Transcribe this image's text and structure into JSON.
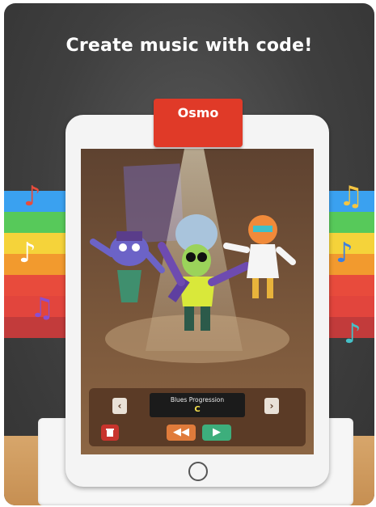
{
  "header": {
    "title": "Create music with code!"
  },
  "device": {
    "clip_brand": "Osmo"
  },
  "stripe_colors": [
    "#3aa1f0",
    "#57c95a",
    "#f5d33a",
    "#f29a2e",
    "#e84b3c",
    "#e2453d",
    "#c23b3b"
  ],
  "notes": [
    {
      "name": "red-note-icon",
      "glyph": "♪",
      "color": "#e74c3c"
    },
    {
      "name": "white-note-icon",
      "glyph": "♪",
      "color": "#ffffff"
    },
    {
      "name": "purple-note-icon",
      "glyph": "♫",
      "color": "#8a4fd1"
    },
    {
      "name": "yellow-note-icon",
      "glyph": "♫",
      "color": "#f5c542"
    },
    {
      "name": "blue-note-icon",
      "glyph": "♪",
      "color": "#3b7fe0"
    },
    {
      "name": "teal-note-icon",
      "glyph": "♪",
      "color": "#45c1c8"
    }
  ],
  "panel": {
    "song_label": "Blues Progression",
    "chord": "C",
    "prev_icon": "chevron-left-icon",
    "next_icon": "chevron-right-icon",
    "delete_icon": "trash-icon",
    "rewind_icon": "rewind-icon",
    "play_icon": "play-icon"
  },
  "colors": {
    "delete": "#c8342d",
    "rewind": "#e07b3b",
    "play": "#3dae7c"
  }
}
